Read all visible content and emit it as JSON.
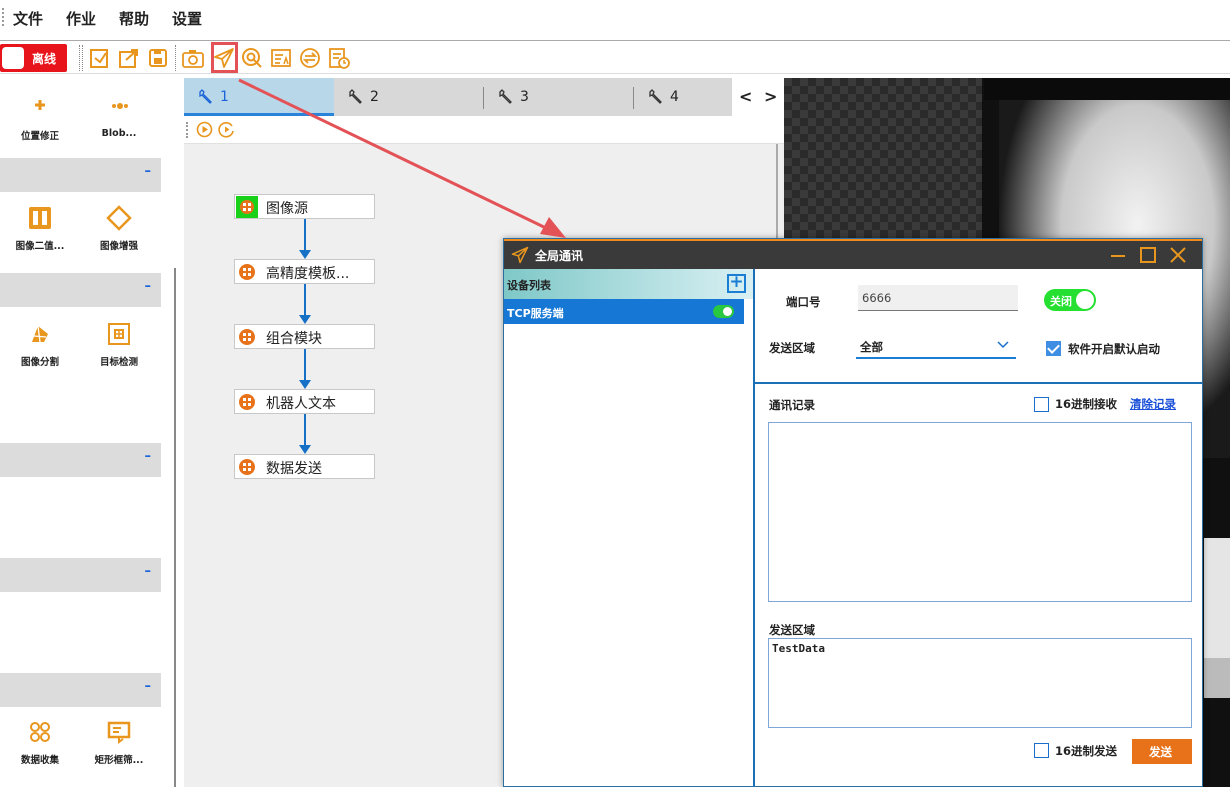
{
  "menu": {
    "items": [
      "文件",
      "作业",
      "帮助",
      "设置"
    ]
  },
  "toolbar": {
    "offline_label": "离线",
    "icons": [
      "import-icon",
      "export-icon",
      "save-icon",
      "camera-icon",
      "send-icon",
      "target-icon",
      "text-icon",
      "swap-icon",
      "schedule-icon"
    ]
  },
  "left_panel": {
    "tools_top": [
      {
        "label": "位置修正",
        "icon": "position-correction-icon"
      },
      {
        "label": "Blob...",
        "icon": "blob-icon"
      }
    ],
    "tools_group2": [
      {
        "label": "图像二值...",
        "icon": "binarize-icon"
      },
      {
        "label": "图像增强",
        "icon": "enhance-icon"
      }
    ],
    "tools_group3": [
      {
        "label": "图像分割",
        "icon": "segment-icon"
      },
      {
        "label": "目标检测",
        "icon": "detect-icon"
      }
    ],
    "tools_group6": [
      {
        "label": "数据收集",
        "icon": "data-collect-icon"
      },
      {
        "label": "矩形框筛...",
        "icon": "rect-filter-icon"
      }
    ],
    "collapse_symbol": "–"
  },
  "flow": {
    "tabs": [
      "1",
      "2",
      "3",
      "4"
    ],
    "nav_prev": "<",
    "nav_next": ">",
    "nodes": [
      "图像源",
      "高精度模板...",
      "组合模块",
      "机器人文本",
      "数据发送"
    ]
  },
  "dialog": {
    "title": "全局通讯",
    "device_list_label": "设备列表",
    "add_symbol": "+",
    "device_name": "TCP服务端",
    "port_label": "端口号",
    "port_value": "6666",
    "port_toggle_label": "关闭",
    "send_area_label": "发送区域",
    "send_area_value": "全部",
    "autostart_label": "软件开启默认启动",
    "autostart_checked": true,
    "log_label": "通讯记录",
    "hex_receive_label": "16进制接收",
    "clear_log_label": "清除记录",
    "send_section_label": "发送区域",
    "send_text": "TestData",
    "hex_send_label": "16进制发送",
    "send_button_label": "发送"
  },
  "colors": {
    "accent_orange": "#f08a1c",
    "offline_red": "#e8141c",
    "active_blue": "#1777d4",
    "toggle_green": "#25e030",
    "send_orange": "#e8721a",
    "annotation_red": "#e35256"
  }
}
